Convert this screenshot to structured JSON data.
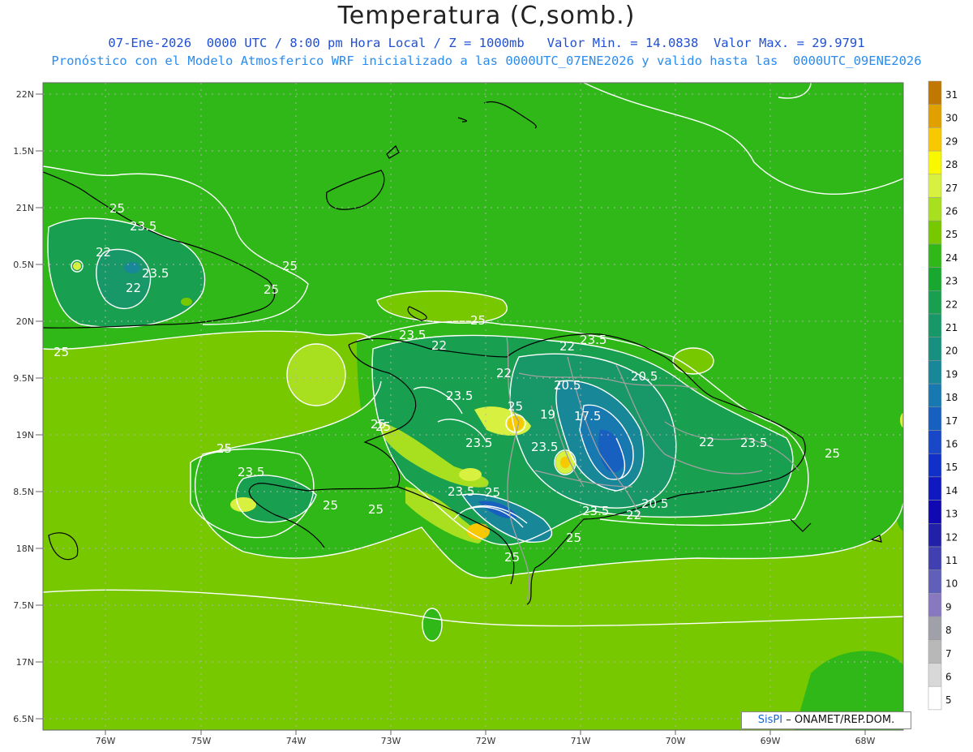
{
  "title": "Temperatura (C,somb.)",
  "subtitle_line1": "07-Ene-2026  0000 UTC / 8:00 pm Hora Local / Z = 1000mb   Valor Min. = 14.0838  Valor Max. = 29.9791",
  "subtitle_line2": "Pronóstico con el Modelo Atmosferico WRF inicializado a las 0000UTC_07ENE2026 y valido hasta las  0000UTC_09ENE2026",
  "credit": {
    "logo": "SisPI",
    "text": " – ONAMET/REP.DOM."
  },
  "axes": {
    "lat_labels": [
      "22N",
      "1.5N",
      "21N",
      "0.5N",
      "20N",
      "9.5N",
      "19N",
      "8.5N",
      "18N",
      "7.5N",
      "17N",
      "6.5N"
    ],
    "lon_labels": [
      "76W",
      "75W",
      "74W",
      "73W",
      "72W",
      "71W",
      "70W",
      "69W",
      "68W"
    ]
  },
  "colorbar": {
    "labels": [
      "31",
      "30",
      "29",
      "28",
      "27",
      "26",
      "25",
      "24",
      "23",
      "22",
      "21",
      "20",
      "19",
      "18",
      "17",
      "16",
      "15",
      "14",
      "13",
      "12",
      "11",
      "10",
      "9",
      "8",
      "7",
      "6",
      "5"
    ],
    "colors": [
      "#c07800",
      "#e0a000",
      "#f8c800",
      "#f8f800",
      "#d8f040",
      "#a8e020",
      "#78c800",
      "#30b818",
      "#18a830",
      "#18a050",
      "#189868",
      "#189080",
      "#188898",
      "#1878b0",
      "#1860c0",
      "#1848c8",
      "#1030c8",
      "#1018c0",
      "#1008b0",
      "#2020a8",
      "#4040b0",
      "#6060b8",
      "#8878c0",
      "#a0a0a8",
      "#b8b8b8",
      "#d8d8d8",
      "#ffffff"
    ]
  },
  "contour_labels": [
    "25",
    "23.5",
    "22",
    "23.5",
    "22",
    "25",
    "25",
    "25",
    "25",
    "23.5",
    "22",
    "25",
    "23.5",
    "22",
    "23.5",
    "25",
    "19",
    "17.5",
    "20.5",
    "20.5",
    "22",
    "23.5",
    "25",
    "25",
    "23.5",
    "23.5",
    "23.5",
    "25",
    "25",
    "25",
    "23.5",
    "22",
    "25",
    "20.5",
    "22",
    "23.5",
    "25",
    "25"
  ]
}
